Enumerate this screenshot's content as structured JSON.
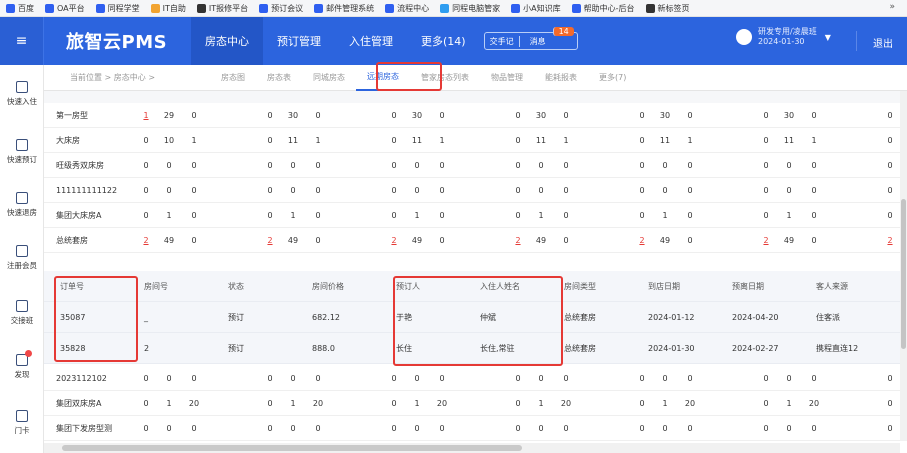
{
  "bookmarks": [
    {
      "label": "百度",
      "color": "#2f5ff0"
    },
    {
      "label": "OA平台",
      "color": "#2f5ff0"
    },
    {
      "label": "同程学堂",
      "color": "#2f5ff0"
    },
    {
      "label": "IT自助",
      "color": "#f2a431"
    },
    {
      "label": "IT报修平台",
      "color": "#333333"
    },
    {
      "label": "预订会议",
      "color": "#2f5ff0"
    },
    {
      "label": "邮件管理系统",
      "color": "#2f5ff0"
    },
    {
      "label": "流程中心",
      "color": "#2f5ff0"
    },
    {
      "label": "同程电脑管家",
      "color": "#2f9df0"
    },
    {
      "label": "小A知识库",
      "color": "#2f5ff0"
    },
    {
      "label": "帮助中心-后台",
      "color": "#2f5ff0"
    },
    {
      "label": "新标签页",
      "color": "#333333"
    }
  ],
  "bookmarks_more": "»",
  "header": {
    "logo": "旅智云PMS",
    "menu_icon": "≡",
    "nav": [
      "房态中心",
      "预订管理",
      "入住管理",
      "更多(14)"
    ],
    "shift_label": "交手记",
    "message_label": "消息",
    "message_badge": "14",
    "user_name": "研发专用/凌晨班",
    "user_date": "2024-01-30",
    "user_caret": "▼",
    "logout": "退出"
  },
  "sidebar": [
    {
      "label": "快速入住",
      "icon": "home-icon"
    },
    {
      "label": "快速预订",
      "icon": "document-icon"
    },
    {
      "label": "快速退房",
      "icon": "house-arrow-icon"
    },
    {
      "label": "注册会员",
      "icon": "member-icon"
    },
    {
      "label": "交接班",
      "icon": "handover-icon"
    },
    {
      "label": "发现",
      "icon": "discover-icon"
    },
    {
      "label": "门卡",
      "icon": "card-icon"
    }
  ],
  "subnav": {
    "breadcrumb": "当前位置 > 房态中心 >",
    "tabs": [
      "房态图",
      "房态表",
      "同城房态",
      "远期房态",
      "管家房态列表",
      "物品管理",
      "能耗报表",
      "更多(7)"
    ],
    "active_tab": 3
  },
  "top_rows": [
    {
      "name": "第一房型",
      "vals": [
        "1",
        "29",
        "0",
        "0",
        "30",
        "0",
        "0",
        "30",
        "0",
        "0",
        "30",
        "0",
        "0",
        "30",
        "0",
        "0",
        "30",
        "0",
        "0",
        "30",
        "0"
      ],
      "red_idx": [
        0
      ]
    },
    {
      "name": "大床房",
      "vals": [
        "0",
        "10",
        "1",
        "0",
        "11",
        "1",
        "0",
        "11",
        "1",
        "0",
        "11",
        "1",
        "0",
        "11",
        "1",
        "0",
        "11",
        "1",
        "0",
        "11",
        "1"
      ],
      "red_idx": []
    },
    {
      "name": "旺级秀双床房",
      "vals": [
        "0",
        "0",
        "0",
        "0",
        "0",
        "0",
        "0",
        "0",
        "0",
        "0",
        "0",
        "0",
        "0",
        "0",
        "0",
        "0",
        "0",
        "0",
        "0",
        "0",
        "0"
      ],
      "red_idx": []
    },
    {
      "name": "111111111122",
      "vals": [
        "0",
        "0",
        "0",
        "0",
        "0",
        "0",
        "0",
        "0",
        "0",
        "0",
        "0",
        "0",
        "0",
        "0",
        "0",
        "0",
        "0",
        "0",
        "0",
        "0",
        "0"
      ],
      "red_idx": []
    },
    {
      "name": "集团大床房A",
      "vals": [
        "0",
        "1",
        "0",
        "0",
        "1",
        "0",
        "0",
        "1",
        "0",
        "0",
        "1",
        "0",
        "0",
        "1",
        "0",
        "0",
        "1",
        "0",
        "0",
        "1",
        "0"
      ],
      "red_idx": []
    },
    {
      "name": "总统套房",
      "vals": [
        "2",
        "49",
        "0",
        "2",
        "49",
        "0",
        "2",
        "49",
        "0",
        "2",
        "49",
        "0",
        "2",
        "49",
        "0",
        "2",
        "49",
        "0",
        "2",
        "49",
        "0"
      ],
      "red_idx": [
        0,
        3,
        6,
        9,
        12,
        15,
        18
      ]
    }
  ],
  "detail": {
    "headers": [
      "订单号",
      "房间号",
      "状态",
      "房间价格",
      "预订人",
      "入住人姓名",
      "房间类型",
      "到店日期",
      "预离日期",
      "客人来源"
    ],
    "rows": [
      [
        "35087",
        "_",
        "预订",
        "682.12",
        "于艳",
        "仲斌",
        "总统套房",
        "2024-01-12",
        "2024-04-20",
        "住客派"
      ],
      [
        "35828",
        "2",
        "预订",
        "888.0",
        "长住",
        "长住,常驻",
        "总统套房",
        "2024-01-30",
        "2024-02-27",
        "携程直连12"
      ]
    ]
  },
  "bottom_rows": [
    {
      "name": "2023112102",
      "vals": [
        "0",
        "0",
        "0",
        "0",
        "0",
        "0",
        "0",
        "0",
        "0",
        "0",
        "0",
        "0",
        "0",
        "0",
        "0",
        "0",
        "0",
        "0",
        "0",
        "0",
        "0"
      ]
    },
    {
      "name": "集团双床房A",
      "vals": [
        "0",
        "1",
        "20",
        "0",
        "1",
        "20",
        "0",
        "1",
        "20",
        "0",
        "1",
        "20",
        "0",
        "1",
        "20",
        "0",
        "1",
        "20",
        "0",
        "1",
        "20"
      ]
    },
    {
      "name": "集团下发房型测",
      "vals": [
        "0",
        "0",
        "0",
        "0",
        "0",
        "0",
        "0",
        "0",
        "0",
        "0",
        "0",
        "0",
        "0",
        "0",
        "0",
        "0",
        "0",
        "0",
        "0",
        "0",
        "0"
      ]
    }
  ]
}
